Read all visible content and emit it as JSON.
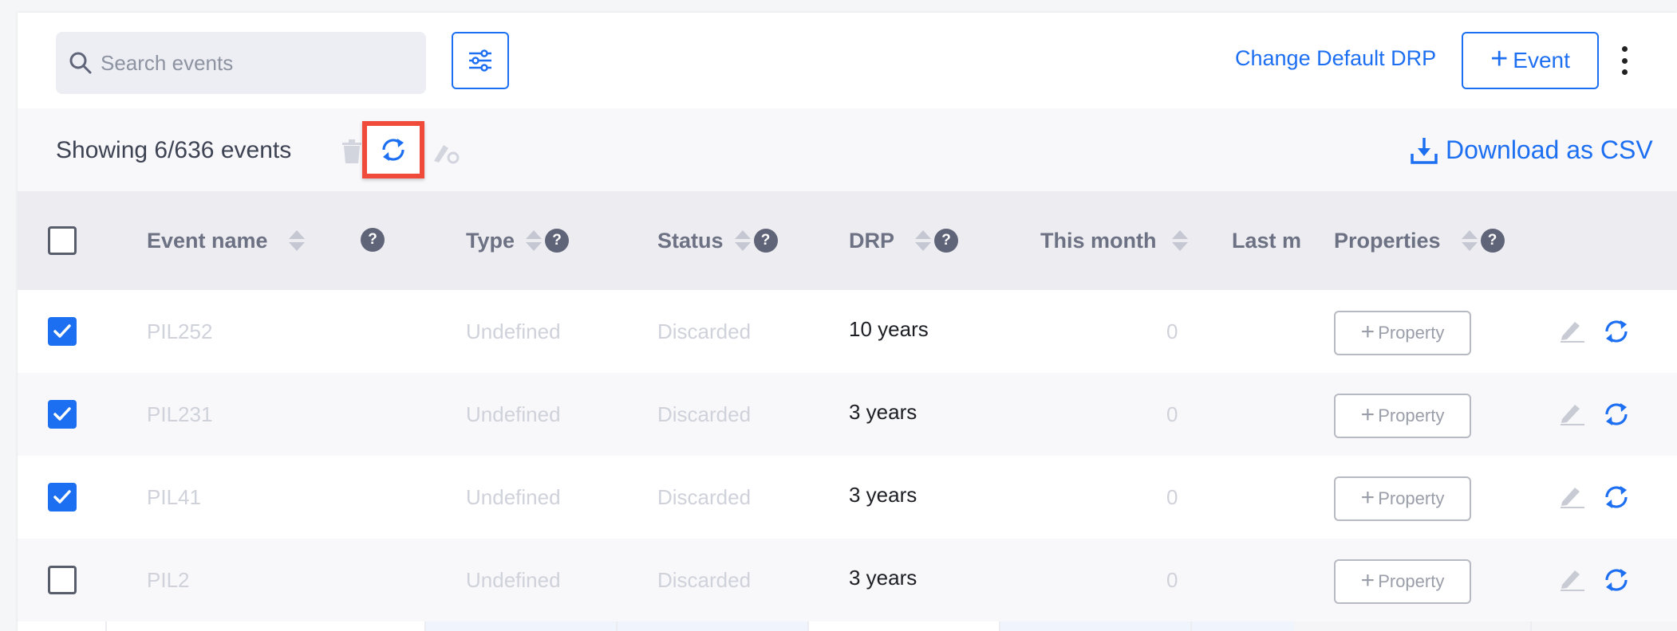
{
  "toolbar": {
    "search_placeholder": "Search events",
    "change_drp_label": "Change Default DRP",
    "event_button_label": "Event"
  },
  "subbar": {
    "showing_text": "Showing 6/636 events",
    "download_label": "Download as CSV"
  },
  "table": {
    "columns": {
      "event_name": "Event name",
      "type": "Type",
      "status": "Status",
      "drp": "DRP",
      "this_month": "This month",
      "last_month": "Last m",
      "properties": "Properties"
    },
    "help_symbol": "?",
    "property_button_label": "Property",
    "rows": [
      {
        "checked": true,
        "name": "PIL252",
        "type": "Undefined",
        "status": "Discarded",
        "drp": "10 years",
        "this_month": "0"
      },
      {
        "checked": true,
        "name": "PIL231",
        "type": "Undefined",
        "status": "Discarded",
        "drp": "3 years",
        "this_month": "0"
      },
      {
        "checked": true,
        "name": "PIL41",
        "type": "Undefined",
        "status": "Discarded",
        "drp": "3 years",
        "this_month": "0"
      },
      {
        "checked": false,
        "name": "PIL2",
        "type": "Undefined",
        "status": "Discarded",
        "drp": "3 years",
        "this_month": "0"
      }
    ]
  },
  "colors": {
    "accent": "#1d6ff2",
    "highlight_frame": "#f04a3a",
    "header_bg": "#ececf1",
    "selected_cell_bg": "#f0f4fc"
  },
  "icons": [
    "search-icon",
    "sliders-icon",
    "kebab-icon",
    "trash-icon",
    "refresh-icon",
    "edit-settings-icon",
    "download-icon",
    "question-icon",
    "pencil-icon",
    "checkmark-icon"
  ]
}
